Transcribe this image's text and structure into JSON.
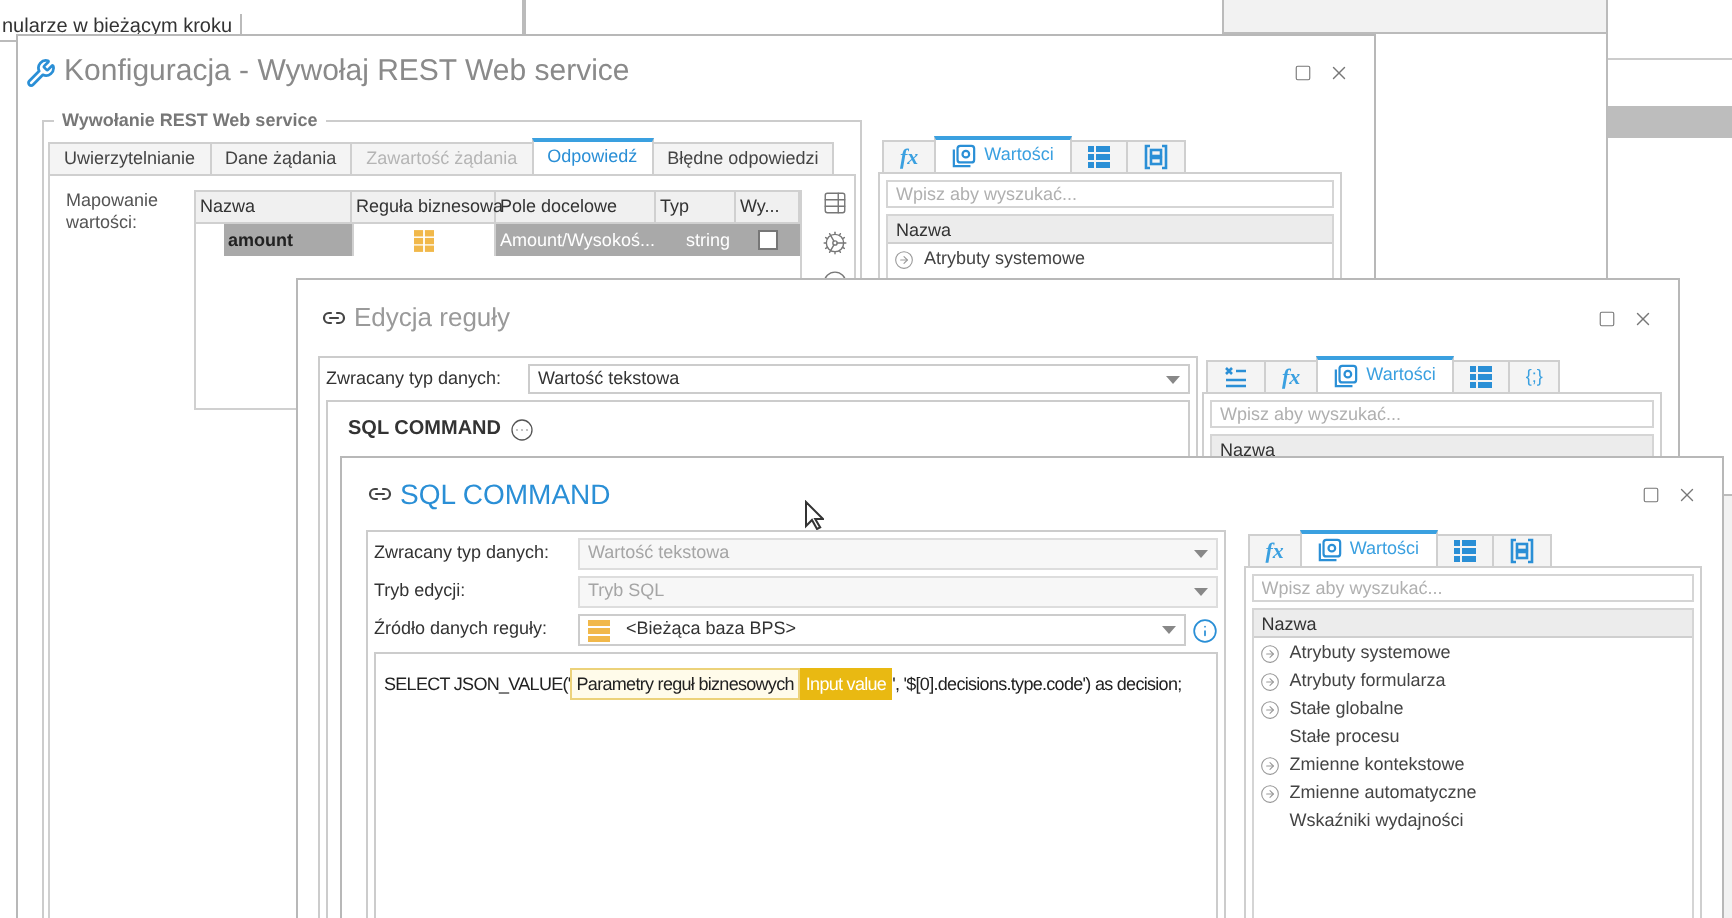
{
  "background": {
    "top_text": "nularze w bieżącym kroku"
  },
  "config_window": {
    "title": "Konfiguracja - Wywołaj REST Web service",
    "group_title": "Wywołanie REST Web service",
    "tabs": [
      {
        "label": "Uwierzytelnianie",
        "selected": false,
        "disabled": false
      },
      {
        "label": "Dane żądania",
        "selected": false,
        "disabled": false
      },
      {
        "label": "Zawartość żądania",
        "selected": false,
        "disabled": true
      },
      {
        "label": "Odpowiedź",
        "selected": true,
        "disabled": false
      },
      {
        "label": "Błędne odpowiedzi",
        "selected": false,
        "disabled": false
      }
    ],
    "mapping_label": "Mapowanie wartości:",
    "table": {
      "columns": [
        "Nazwa",
        "Reguła biznesowa",
        "Pole docelowe",
        "Typ",
        "Wy..."
      ],
      "rows": [
        {
          "name": "amount",
          "target": "Amount/Wysokoś...",
          "type": "string",
          "checked": false
        }
      ]
    },
    "values_panel": {
      "tabs": [
        {
          "kind": "fx",
          "label": "fx",
          "selected": false
        },
        {
          "kind": "values",
          "label": "Wartości",
          "selected": true
        },
        {
          "kind": "list",
          "selected": false
        },
        {
          "kind": "brackets",
          "selected": false
        }
      ],
      "search": {
        "placeholder": "Wpisz aby wyszukać..."
      },
      "header": "Nazwa",
      "items": [
        {
          "label": "Atrybuty systemowe",
          "expandable": true
        }
      ]
    }
  },
  "rule_window": {
    "title": "Edycja reguły",
    "return_type_label": "Zwracany typ danych:",
    "return_type": "Wartość tekstowa",
    "block_title": "SQL COMMAND",
    "values_panel": {
      "tabs": [
        {
          "kind": "assign",
          "selected": false
        },
        {
          "kind": "fx",
          "label": "fx",
          "selected": false
        },
        {
          "kind": "values",
          "label": "Wartości",
          "selected": true
        },
        {
          "kind": "list",
          "selected": false
        },
        {
          "kind": "code",
          "label": "{;}",
          "selected": false
        }
      ],
      "search": {
        "placeholder": "Wpisz aby wyszukać..."
      },
      "header": "Nazwa"
    }
  },
  "sql_window": {
    "title": "SQL COMMAND",
    "fields": [
      {
        "kind": "select",
        "label": "Zwracany typ danych:",
        "value": "Wartość tekstowa",
        "disabled": true
      },
      {
        "kind": "select",
        "label": "Tryb edycji:",
        "value": "Tryb SQL",
        "disabled": true
      },
      {
        "kind": "source",
        "label": "Źródło danych reguły:",
        "value": "<Bieżąca baza BPS>",
        "disabled": false
      }
    ],
    "code": [
      {
        "kind": "text",
        "text": "SELECT JSON_VALUE('"
      },
      {
        "kind": "token",
        "text": "Parametry reguł biznesowych"
      },
      {
        "kind": "token_value",
        "text": "Input value"
      },
      {
        "kind": "text",
        "text": "', '$[0].decisions.type.code') as decision;"
      }
    ],
    "values_panel": {
      "tabs": [
        {
          "kind": "fx",
          "label": "fx",
          "selected": false
        },
        {
          "kind": "values",
          "label": "Wartości",
          "selected": true
        },
        {
          "kind": "list",
          "selected": false
        },
        {
          "kind": "brackets",
          "selected": false
        }
      ],
      "search": {
        "placeholder": "Wpisz aby wyszukać..."
      },
      "header": "Nazwa",
      "items": [
        {
          "label": "Atrybuty systemowe",
          "expandable": true
        },
        {
          "label": "Atrybuty formularza",
          "expandable": true
        },
        {
          "label": "Stałe globalne",
          "expandable": true
        },
        {
          "label": "Stałe procesu",
          "expandable": false
        },
        {
          "label": "Zmienne kontekstowe",
          "expandable": true
        },
        {
          "label": "Zmienne automatyczne",
          "expandable": true
        },
        {
          "label": "Wskaźniki wydajności",
          "expandable": false
        }
      ]
    }
  }
}
